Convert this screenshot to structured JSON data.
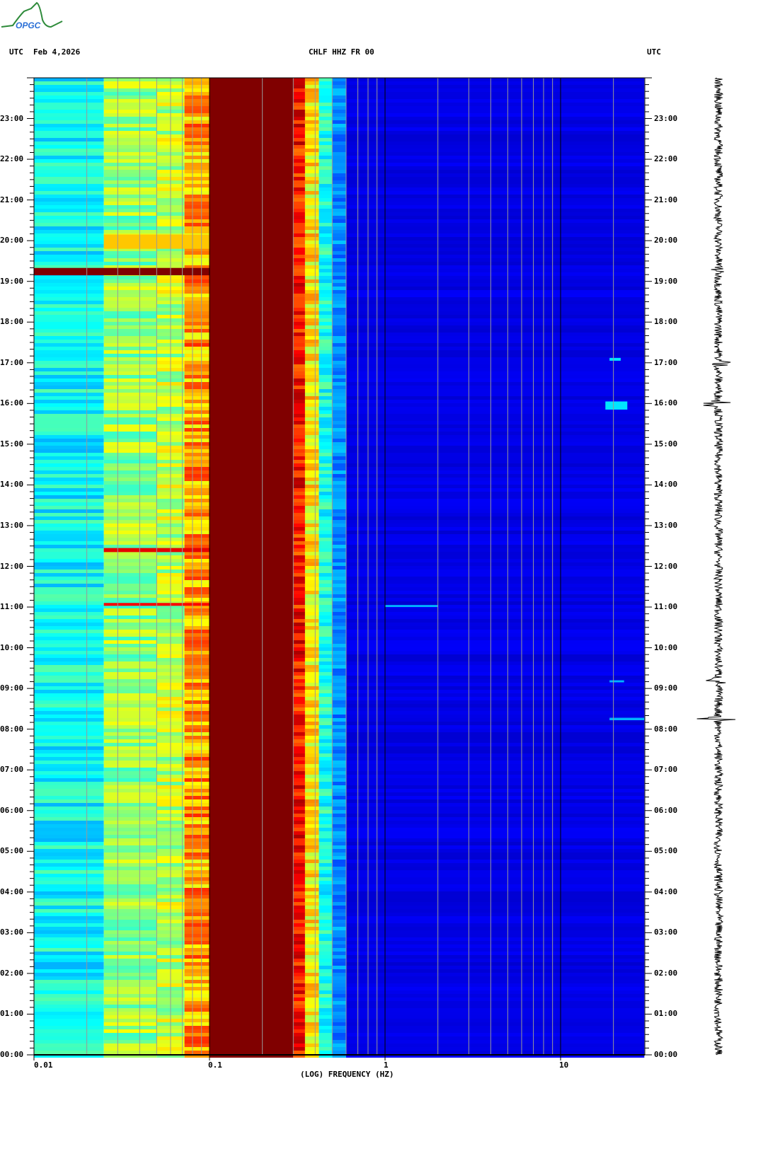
{
  "logo": {
    "text": "OPGC",
    "curve_color": "#2e8b3a",
    "text_color": "#2a6fd6"
  },
  "header": {
    "left_tz": "UTC",
    "date": "Feb 4,2026",
    "station": "CHLF HHZ FR 00",
    "right_tz": "UTC"
  },
  "chart_data": {
    "type": "heatmap",
    "title": "CHLF HHZ FR 00",
    "xlabel": "(LOG) FREQUENCY (HZ)",
    "ylabel": "UTC",
    "xscale": "log",
    "xlim": [
      0.01,
      30
    ],
    "ylim_hours": [
      0,
      24
    ],
    "colormap": "jet",
    "x_ticks": [
      {
        "value": 0.01,
        "label": "0.01"
      },
      {
        "value": 0.1,
        "label": "0.1"
      },
      {
        "value": 1,
        "label": "1"
      },
      {
        "value": 10,
        "label": "10"
      }
    ],
    "grid_minor_freqs": [
      0.02,
      0.03,
      0.04,
      0.05,
      0.06,
      0.07,
      0.08,
      0.09,
      0.2,
      0.3,
      0.4,
      0.5,
      0.6,
      0.7,
      0.8,
      0.9,
      2,
      3,
      4,
      5,
      6,
      7,
      8,
      9,
      20
    ],
    "y_ticks": [
      "00:00",
      "01:00",
      "02:00",
      "03:00",
      "04:00",
      "05:00",
      "06:00",
      "07:00",
      "08:00",
      "09:00",
      "10:00",
      "11:00",
      "12:00",
      "13:00",
      "14:00",
      "15:00",
      "16:00",
      "17:00",
      "18:00",
      "19:00",
      "20:00",
      "21:00",
      "22:00",
      "23:00"
    ],
    "bands": [
      {
        "f_min": 0.01,
        "f_max": 0.025,
        "level": 0.38,
        "var": 0.08
      },
      {
        "f_min": 0.025,
        "f_max": 0.05,
        "level": 0.52,
        "var": 0.1
      },
      {
        "f_min": 0.05,
        "f_max": 0.072,
        "level": 0.56,
        "var": 0.1
      },
      {
        "f_min": 0.072,
        "f_max": 0.1,
        "level": 0.72,
        "var": 0.12
      },
      {
        "f_min": 0.1,
        "f_max": 0.3,
        "level": 1.0,
        "var": 0.0
      },
      {
        "f_min": 0.3,
        "f_max": 0.35,
        "level": 0.86,
        "var": 0.1
      },
      {
        "f_min": 0.35,
        "f_max": 0.42,
        "level": 0.64,
        "var": 0.1
      },
      {
        "f_min": 0.42,
        "f_max": 0.5,
        "level": 0.4,
        "var": 0.08
      },
      {
        "f_min": 0.5,
        "f_max": 0.6,
        "level": 0.26,
        "var": 0.06
      },
      {
        "f_min": 0.6,
        "f_max": 30,
        "level": 0.1,
        "var": 0.02
      }
    ],
    "events": [
      {
        "t_start": 19.15,
        "t_end": 19.33,
        "f_min": 0.01,
        "f_max": 0.1,
        "level": 1.0
      },
      {
        "t_start": 19.8,
        "t_end": 20.15,
        "f_min": 0.025,
        "f_max": 0.1,
        "level": 0.68
      },
      {
        "t_start": 12.35,
        "t_end": 12.45,
        "f_min": 0.025,
        "f_max": 0.1,
        "level": 0.9
      },
      {
        "t_start": 11.03,
        "t_end": 11.1,
        "f_min": 0.025,
        "f_max": 0.1,
        "level": 0.88
      },
      {
        "t_start": 11.0,
        "t_end": 11.05,
        "f_min": 1.0,
        "f_max": 2.0,
        "level": 0.3
      },
      {
        "t_start": 17.05,
        "t_end": 17.12,
        "f_min": 19,
        "f_max": 22,
        "level": 0.35
      },
      {
        "t_start": 15.85,
        "t_end": 16.05,
        "f_min": 18,
        "f_max": 24,
        "level": 0.35
      },
      {
        "t_start": 9.15,
        "t_end": 9.2,
        "f_min": 19,
        "f_max": 23,
        "level": 0.3
      },
      {
        "t_start": 8.22,
        "t_end": 8.28,
        "f_min": 19,
        "f_max": 30,
        "level": 0.3
      }
    ],
    "seismogram_bursts": [
      {
        "time": 8.25,
        "amplitude": 35
      },
      {
        "time": 9.2,
        "amplitude": 18
      },
      {
        "time": 16.0,
        "amplitude": 32
      },
      {
        "time": 17.0,
        "amplitude": 26
      },
      {
        "time": 19.3,
        "amplitude": 10
      }
    ]
  }
}
